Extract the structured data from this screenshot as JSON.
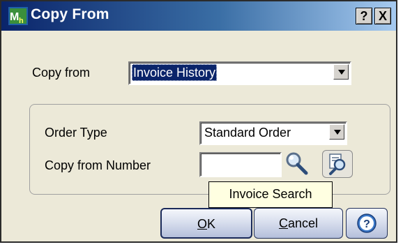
{
  "window": {
    "title": "Copy From",
    "help_button": "?",
    "close_button": "X",
    "app_icon": "mas-app-icon"
  },
  "copy_from": {
    "label": "Copy from",
    "value": "Invoice History"
  },
  "order_section": {
    "order_type_label": "Order Type",
    "order_type_value": "Standard Order",
    "copy_from_number_label": "Copy from Number",
    "copy_from_number_value": "",
    "lookup_icon": "magnifier-icon",
    "search_icon": "invoice-search-icon"
  },
  "tooltip": {
    "text": "Invoice Search"
  },
  "buttons": {
    "ok_mnemonic": "O",
    "ok_rest": "K",
    "cancel_mnemonic": "C",
    "cancel_rest": "ancel",
    "help_icon": "help-question-icon"
  },
  "colors": {
    "title_gradient_start": "#0a246a",
    "title_gradient_end": "#a6caf0",
    "dialog_bg": "#ece9d8",
    "selection": "#0a246a",
    "tooltip_bg": "#ffffe1"
  }
}
